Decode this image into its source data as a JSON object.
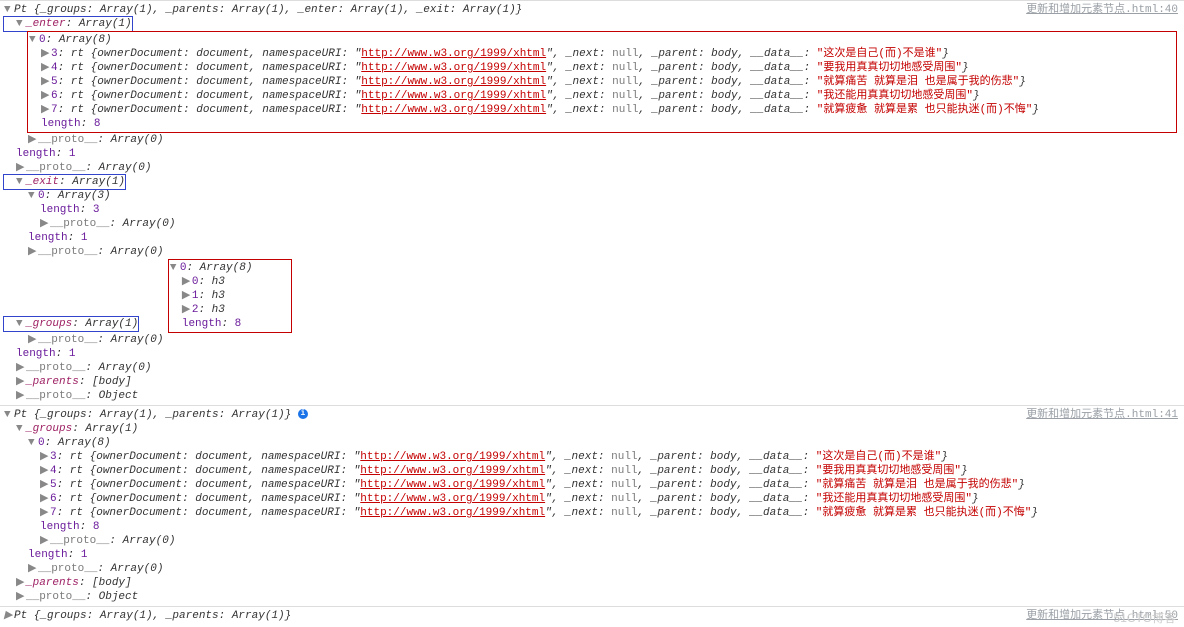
{
  "sources": {
    "s40": "更新和增加元素节点.html:40",
    "s41": "更新和增加元素节点.html:41",
    "s50": "更新和增加元素节点.html:50"
  },
  "block1": {
    "header": "Pt {_groups: Array(1), _parents: Array(1), _enter: Array(1), _exit: Array(1)}",
    "enter": {
      "label": "_enter",
      "type": "Array(1)",
      "inner": {
        "idx": "0",
        "type": "Array(8)",
        "length": "8",
        "proto": "Array(0)"
      },
      "rows": [
        {
          "i": "3",
          "owner": "document",
          "ns": "http://www.w3.org/1999/xhtml",
          "next": "null",
          "parent": "body",
          "data": "这次是自己(而)不是谁"
        },
        {
          "i": "4",
          "owner": "document",
          "ns": "http://www.w3.org/1999/xhtml",
          "next": "null",
          "parent": "body",
          "data": "要我用真真切切地感受周围"
        },
        {
          "i": "5",
          "owner": "document",
          "ns": "http://www.w3.org/1999/xhtml",
          "next": "null",
          "parent": "body",
          "data": "就算痛苦 就算是泪 也是属于我的伤悲"
        },
        {
          "i": "6",
          "owner": "document",
          "ns": "http://www.w3.org/1999/xhtml",
          "next": "null",
          "parent": "body",
          "data": "我还能用真真切切地感受周围"
        },
        {
          "i": "7",
          "owner": "document",
          "ns": "http://www.w3.org/1999/xhtml",
          "next": "null",
          "parent": "body",
          "data": "就算疲惫 就算是累 也只能执迷(而)不悔"
        }
      ],
      "outerLen": "1",
      "outerProto": "Array(0)"
    },
    "exit": {
      "label": "_exit",
      "type": "Array(1)",
      "inner": {
        "idx": "0",
        "type": "Array(3)",
        "length": "3",
        "proto": "Array(0)"
      },
      "outerLen": "1",
      "outerProto": "Array(0)"
    },
    "groups": {
      "label": "_groups",
      "type": "Array(1)",
      "inner": {
        "idx": "0",
        "type": "Array(8)",
        "length": "8",
        "proto": "Array(0)"
      },
      "items": [
        {
          "i": "0",
          "v": "h3"
        },
        {
          "i": "1",
          "v": "h3"
        },
        {
          "i": "2",
          "v": "h3"
        }
      ],
      "outerLen": "1",
      "outerProto": "Array(0)"
    },
    "parents": {
      "label": "_parents",
      "val": "[body]"
    },
    "proto": {
      "label": "__proto__",
      "val": "Object"
    }
  },
  "block2": {
    "header": "Pt {_groups: Array(1), _parents: Array(1)}",
    "groups": {
      "label": "_groups",
      "type": "Array(1)",
      "inner": {
        "idx": "0",
        "type": "Array(8)",
        "length": "8",
        "proto": "Array(0)"
      },
      "rows": [
        {
          "i": "3",
          "owner": "document",
          "ns": "http://www.w3.org/1999/xhtml",
          "next": "null",
          "parent": "body",
          "data": "这次是自己(而)不是谁"
        },
        {
          "i": "4",
          "owner": "document",
          "ns": "http://www.w3.org/1999/xhtml",
          "next": "null",
          "parent": "body",
          "data": "要我用真真切切地感受周围"
        },
        {
          "i": "5",
          "owner": "document",
          "ns": "http://www.w3.org/1999/xhtml",
          "next": "null",
          "parent": "body",
          "data": "就算痛苦 就算是泪 也是属于我的伤悲"
        },
        {
          "i": "6",
          "owner": "document",
          "ns": "http://www.w3.org/1999/xhtml",
          "next": "null",
          "parent": "body",
          "data": "我还能用真真切切地感受周围"
        },
        {
          "i": "7",
          "owner": "document",
          "ns": "http://www.w3.org/1999/xhtml",
          "next": "null",
          "parent": "body",
          "data": "就算疲惫 就算是累 也只能执迷(而)不悔"
        }
      ],
      "outerLen": "1",
      "outerProto": "Array(0)"
    },
    "parents": {
      "label": "_parents",
      "val": "[body]"
    },
    "proto": {
      "label": "__proto__",
      "val": "Object"
    }
  },
  "block3": {
    "header": "Pt {_groups: Array(1), _parents: Array(1)}"
  },
  "watermark": "51CTO博客"
}
